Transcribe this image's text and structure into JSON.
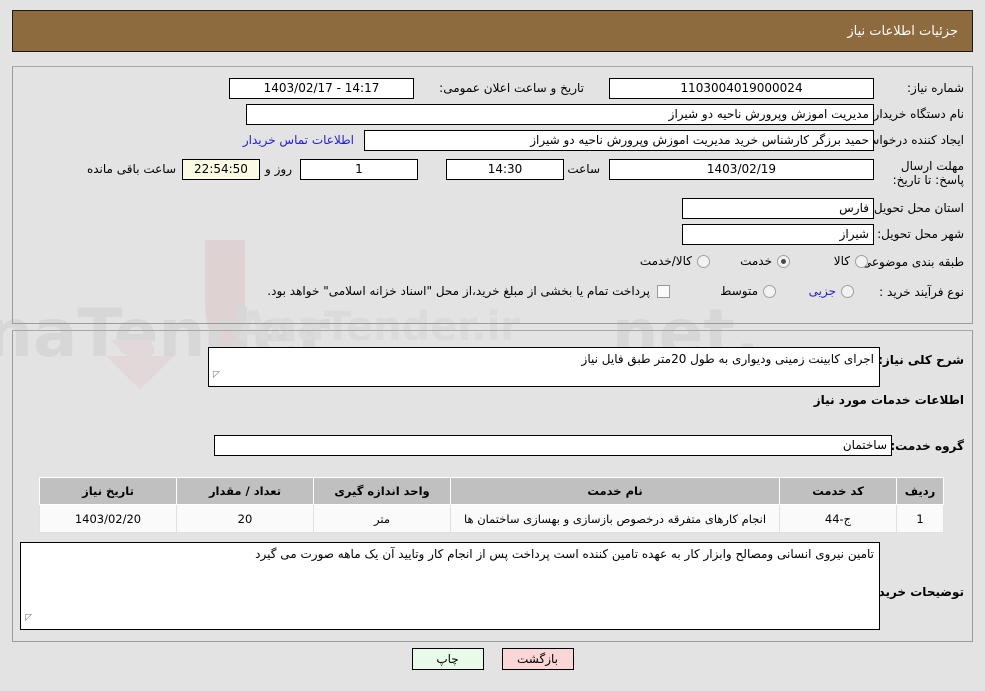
{
  "header": {
    "title": "جزئیات اطلاعات نیاز",
    "bg_color": "#8d6b3f"
  },
  "info": {
    "need_number_label": "شماره نیاز:",
    "need_number": "1103004019000024",
    "announce_label": "تاریخ و ساعت اعلان عمومی:",
    "announce_value": "14:17 - 1403/02/17",
    "buyer_org_label": "نام دستگاه خریدار:",
    "buyer_org": "مدیریت اموزش وپرورش ناحیه دو شیراز",
    "creator_label": "ایجاد کننده درخواست:",
    "creator": "حمید برزگر کارشناس خرید مدیریت اموزش وپرورش ناحیه دو شیراز",
    "contact_link": "اطلاعات تماس خریدار",
    "deadline_label": "مهلت ارسال پاسخ: تا تاریخ:",
    "deadline_date": "1403/02/19",
    "hour_label": "ساعت",
    "deadline_time": "14:30",
    "days_value": "1",
    "days_label": "روز و",
    "countdown": "22:54:50",
    "countdown_label": "ساعت باقی مانده",
    "province_label": "استان محل تحویل:",
    "province": "فارس",
    "city_label": "شهر محل تحویل:",
    "city": "شیراز",
    "category_label": "طبقه بندی موضوعی:",
    "category_options": [
      {
        "label": "کالا",
        "selected": false
      },
      {
        "label": "خدمت",
        "selected": true
      },
      {
        "label": "کالا/خدمت",
        "selected": false
      }
    ],
    "process_label": "نوع فرآیند خرید :",
    "process_options": [
      {
        "label": "جزیی",
        "selected": false
      },
      {
        "label": "متوسط",
        "selected": false
      }
    ],
    "treasury_checkbox": false,
    "treasury_note": "پرداخت تمام یا بخشی از مبلغ خرید،از محل \"اسناد خزانه اسلامی\" خواهد بود."
  },
  "detail": {
    "general_desc_label": "شرح کلی نیاز:",
    "general_desc": "اجرای کابینت زمینی ودیواری به طول 20متر طبق فایل نیاز",
    "services_heading": "اطلاعات خدمات مورد نیاز",
    "service_group_label": "گروه خدمت:",
    "service_group": "ساختمان",
    "table": {
      "headers": [
        "ردیف",
        "کد خدمت",
        "نام خدمت",
        "واحد اندازه گیری",
        "تعداد / مقدار",
        "تاریخ نیاز"
      ],
      "rows": [
        {
          "row": "1",
          "code": "ج-44",
          "name": "انجام کارهای متفرقه درخصوص بازسازی و بهسازی ساختمان ها",
          "unit": "متر",
          "qty": "20",
          "date": "1403/02/20"
        }
      ]
    },
    "buyer_notes_label": "توضیحات خریدار:",
    "buyer_notes": "تامین نیروی انسانی ومصالح وابزار کار به عهده تامین کننده است پرداخت پس از انجام کار وتایید آن یک ماهه صورت می گیرد"
  },
  "footer": {
    "print_label": "چاپ",
    "back_label": "بازگشت"
  }
}
